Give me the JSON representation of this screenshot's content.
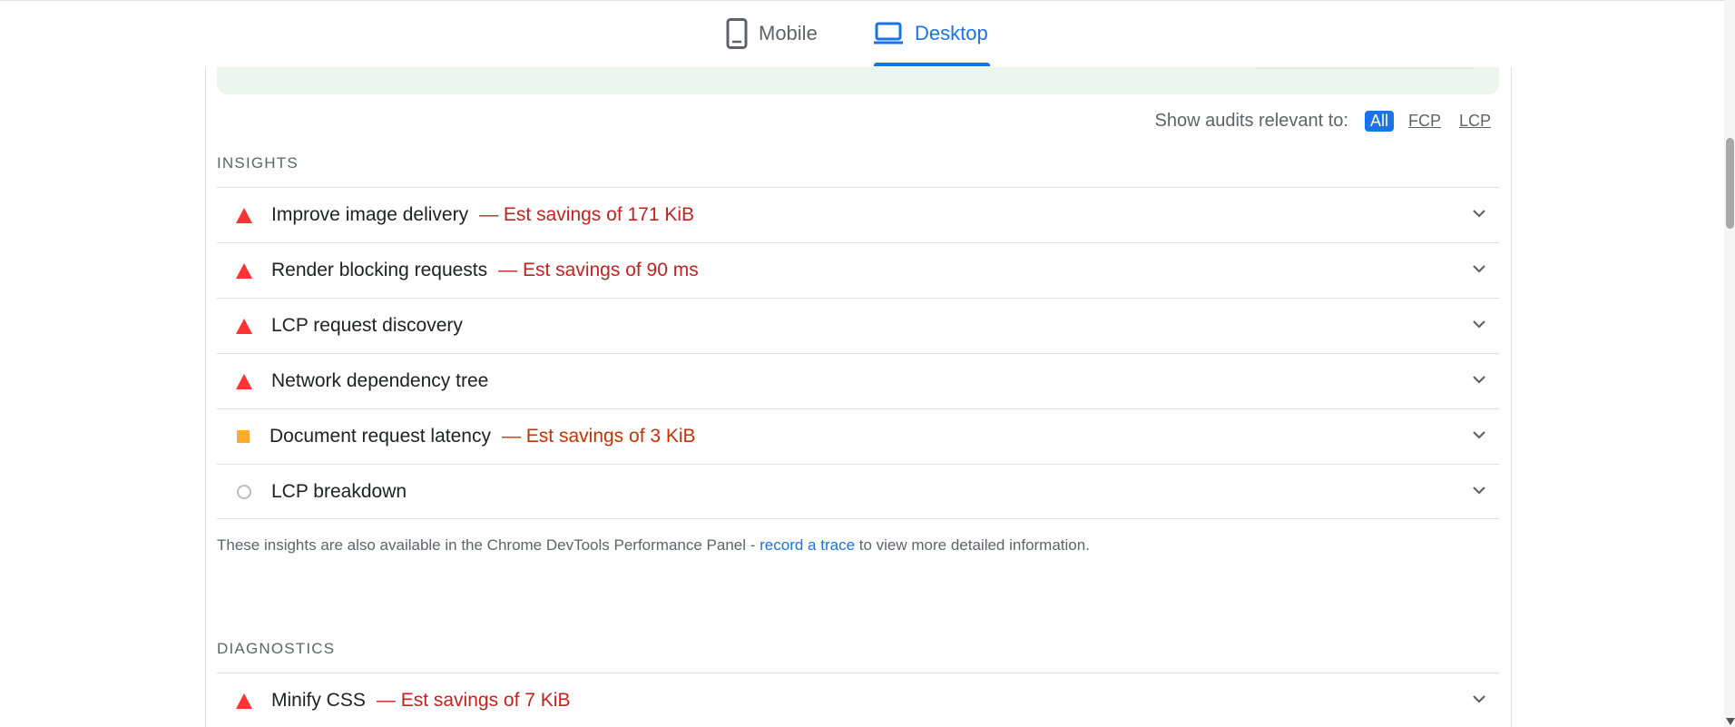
{
  "tabs": [
    {
      "label": "Mobile",
      "icon": "mobile-phone-icon",
      "active": false
    },
    {
      "label": "Desktop",
      "icon": "laptop-icon",
      "active": true
    }
  ],
  "filter": {
    "label": "Show audits relevant to:",
    "options": [
      "All",
      "FCP",
      "LCP"
    ],
    "selected": "All"
  },
  "insights": {
    "title": "INSIGHTS",
    "items": [
      {
        "title": "Improve image delivery",
        "savings": "— Est savings of 171 KiB",
        "status": "fail"
      },
      {
        "title": "Render blocking requests",
        "savings": "— Est savings of 90 ms",
        "status": "fail"
      },
      {
        "title": "LCP request discovery",
        "savings": "",
        "status": "fail"
      },
      {
        "title": "Network dependency tree",
        "savings": "",
        "status": "fail"
      },
      {
        "title": "Document request latency",
        "savings": "— Est savings of 3 KiB",
        "status": "average"
      },
      {
        "title": "LCP breakdown",
        "savings": "",
        "status": "informative"
      }
    ],
    "note_before": "These insights are also available in the Chrome DevTools Performance Panel - ",
    "note_link": "record a trace",
    "note_after": " to view more detailed information."
  },
  "diagnostics": {
    "title": "DIAGNOSTICS",
    "items": [
      {
        "title": "Minify CSS",
        "savings": "— Est savings of 7 KiB",
        "status": "fail"
      }
    ]
  },
  "colors": {
    "accent": "#1a73e8",
    "fail": "#ff3333",
    "fail_text": "#c5221f",
    "average": "#ffaa33",
    "average_text": "#c33300",
    "banner": "#ebf6ee"
  }
}
